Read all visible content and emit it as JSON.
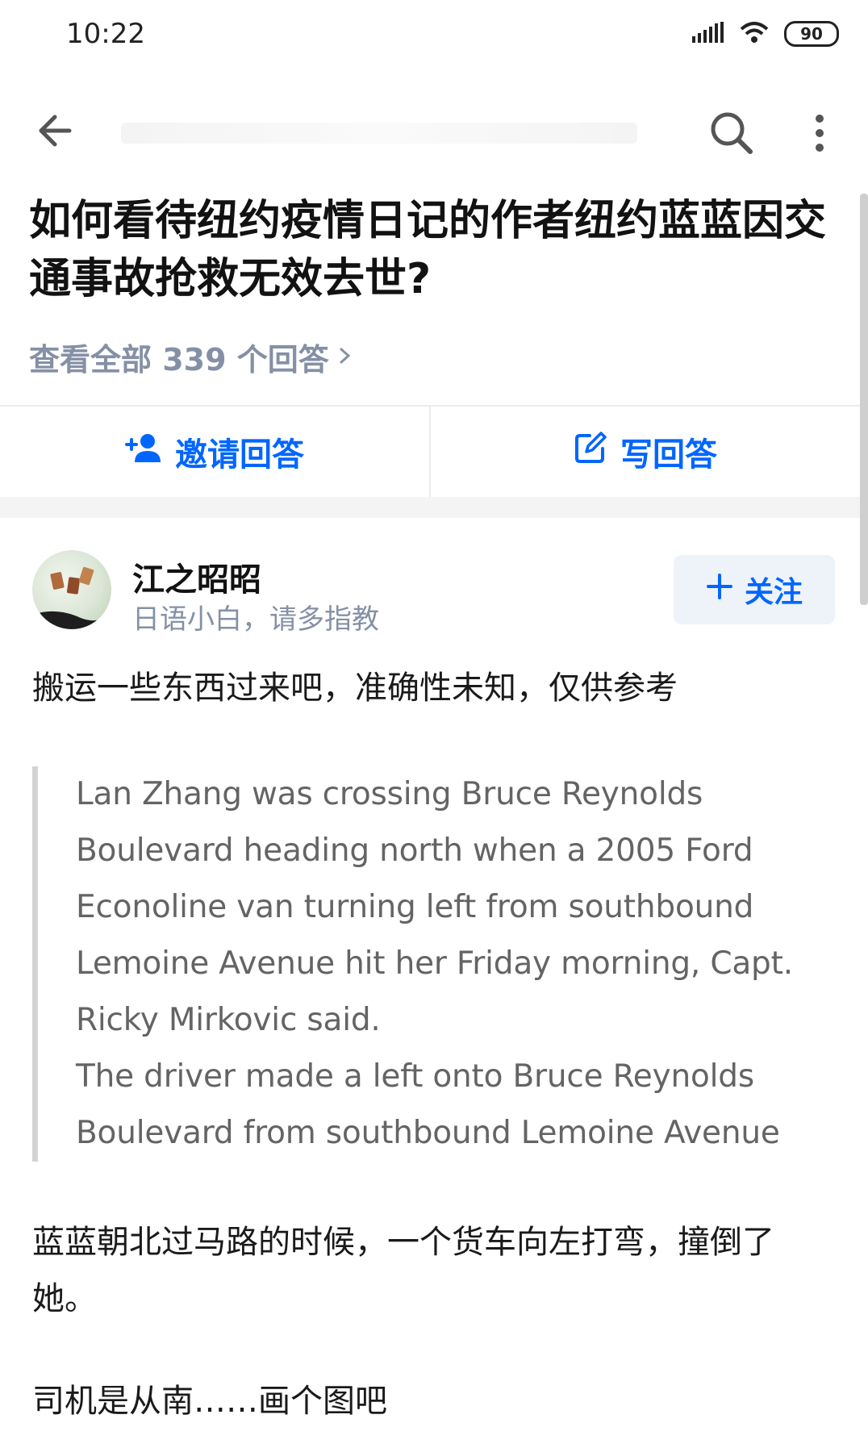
{
  "status_bar": {
    "time": "10:22",
    "battery": "90",
    "icons": [
      "signal-icon",
      "wifi-icon",
      "battery-icon"
    ]
  },
  "app_bar": {
    "icons": [
      "back-arrow-icon",
      "search-icon",
      "more-vertical-icon"
    ]
  },
  "question": {
    "title": "如何看待纽约疫情日记的作者纽约蓝蓝因交通事故抢救无效去世?",
    "view_all": "查看全部 339 个回答"
  },
  "actions": {
    "invite_label": "邀请回答",
    "write_label": "写回答"
  },
  "answer": {
    "author_name": "江之昭昭",
    "author_bio": "日语小白，请多指教",
    "follow_label": "关注",
    "intro": "搬运一些东西过来吧，准确性未知，仅供参考",
    "quote_lines": [
      "Lan Zhang was crossing Bruce Reynolds",
      "Boulevard heading north when a 2005 Ford",
      "Econoline van turning left from southbound",
      "Lemoine Avenue hit her Friday morning, Capt.",
      "Ricky Mirkovic said.",
      "The driver made a left onto Bruce Reynolds",
      "Boulevard from southbound Lemoine Avenue"
    ],
    "paragraph_2": "蓝蓝朝北过马路的时候，一个货车向左打弯，撞倒了她。",
    "paragraph_3": "司机是从南……画个图吧"
  },
  "colors": {
    "accent": "#0066ff",
    "meta_gray": "#8590a6",
    "quote_text": "#646464",
    "quote_border": "#d3d3d3"
  }
}
